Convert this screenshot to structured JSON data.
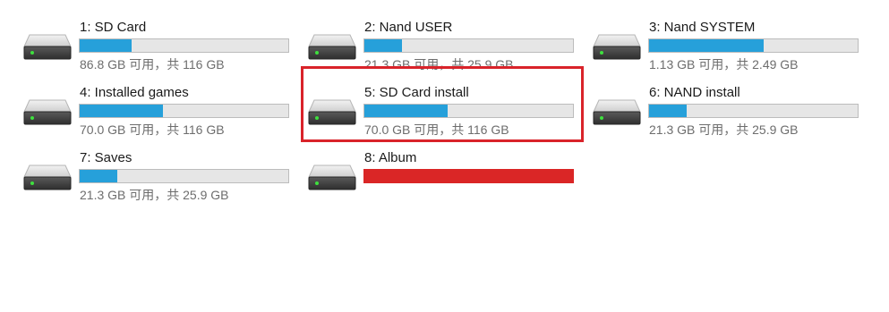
{
  "drives": [
    {
      "name": "1: SD Card",
      "size": "86.8 GB 可用，共 116 GB",
      "used_fraction": 0.25,
      "bar_color": "#26a0da",
      "icon": "hard-drive-icon"
    },
    {
      "name": "2: Nand USER",
      "size": "21.3 GB 可用，共 25.9 GB",
      "used_fraction": 0.18,
      "bar_color": "#26a0da",
      "icon": "hard-drive-icon"
    },
    {
      "name": "3: Nand SYSTEM",
      "size": "1.13 GB 可用，共 2.49 GB",
      "used_fraction": 0.55,
      "bar_color": "#26a0da",
      "icon": "hard-drive-icon"
    },
    {
      "name": "4: Installed games",
      "size": "70.0 GB 可用，共 116 GB",
      "used_fraction": 0.4,
      "bar_color": "#26a0da",
      "icon": "hard-drive-icon"
    },
    {
      "name": "5: SD Card install",
      "size": "70.0 GB 可用，共 116 GB",
      "used_fraction": 0.4,
      "bar_color": "#26a0da",
      "icon": "hard-drive-icon"
    },
    {
      "name": "6: NAND install",
      "size": "21.3 GB 可用，共 25.9 GB",
      "used_fraction": 0.18,
      "bar_color": "#26a0da",
      "icon": "hard-drive-icon"
    },
    {
      "name": "7: Saves",
      "size": "21.3 GB 可用，共 25.9 GB",
      "used_fraction": 0.18,
      "bar_color": "#26a0da",
      "icon": "hard-drive-icon"
    },
    {
      "name": "8: Album",
      "size": "",
      "used_fraction": 1.0,
      "bar_color": "#da2626",
      "icon": "hard-drive-icon"
    }
  ],
  "highlighted_drive": "5: SD Card install",
  "highlight_color": "#d9232a"
}
